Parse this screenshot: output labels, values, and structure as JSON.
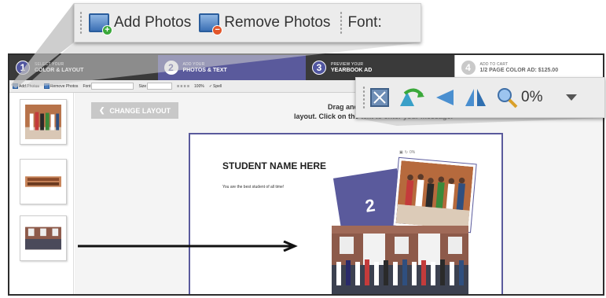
{
  "steps": [
    {
      "num": "1",
      "top": "SELECT YOUR",
      "bottom": "COLOR & LAYOUT"
    },
    {
      "num": "2",
      "top": "ADD YOUR",
      "bottom": "PHOTOS & TEXT"
    },
    {
      "num": "3",
      "top": "PREVIEW YOUR",
      "bottom": "YEARBOOK AD"
    },
    {
      "num": "4",
      "top": "ADD TO CART",
      "bottom": "1/2 PAGE COLOR AD: $125.00"
    }
  ],
  "toolbar": {
    "add_photos": "Add Photos",
    "remove_photos": "Remove Photos",
    "font_label": "Font",
    "size_label": "Size",
    "zoom": "100%",
    "spell": "Spell"
  },
  "zoom_top": {
    "add_photos": "Add Photos",
    "remove_photos": "Remove Photos",
    "font_label": "Font:"
  },
  "zoom_right": {
    "rotation": "0%"
  },
  "content": {
    "change_layout": "CHANGE LAYOUT",
    "instruction_line1": "Drag and drop your photos",
    "instruction_line2": "layout. Click on the text to enter your message.",
    "student_name": "STUDENT NAME HERE",
    "message": "You are the best student of all time!",
    "placeholder_number": "2",
    "mini_zoom": "0%"
  },
  "colors": {
    "accent": "#5a5a9c",
    "step_bar": "#2c2b2c",
    "add_badge": "#3aa83a",
    "remove_badge": "#e2562a"
  },
  "icons": [
    "photo-add-icon",
    "photo-remove-icon",
    "fit-icon",
    "rotate-icon",
    "flip-left-icon",
    "mirror-icon",
    "zoom-icon",
    "dropdown-icon",
    "arrow-right-icon"
  ]
}
